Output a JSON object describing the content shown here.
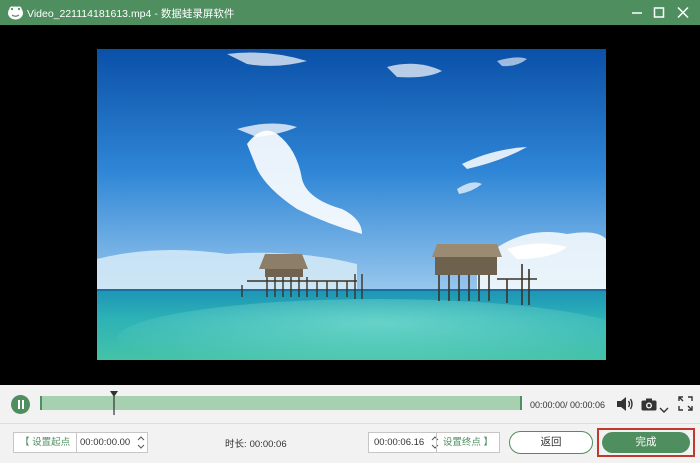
{
  "window": {
    "file_name": "Video_221114181613.mp4",
    "separator": "-",
    "app_name": "数据蛙录屏软件",
    "titlebar_color": "#4f8e5f"
  },
  "video": {
    "content": "tropical sea with stilt huts under blue sky"
  },
  "playback": {
    "state": "playing",
    "time_display": "00:00:00/ 00:00:06",
    "progress_fraction": 0.15
  },
  "trim": {
    "set_start_label": "【 设置起点",
    "start_value": "00:00:00.00",
    "duration_label": "时长:",
    "duration_value": "00:00:06",
    "end_value": "00:00:06.16",
    "set_end_label": "设置终点 】"
  },
  "actions": {
    "back_label": "返回",
    "done_label": "完成"
  },
  "colors": {
    "accent": "#4f8e5f",
    "timeline_fill": "#a6d0af",
    "highlight": "#c0392b"
  }
}
